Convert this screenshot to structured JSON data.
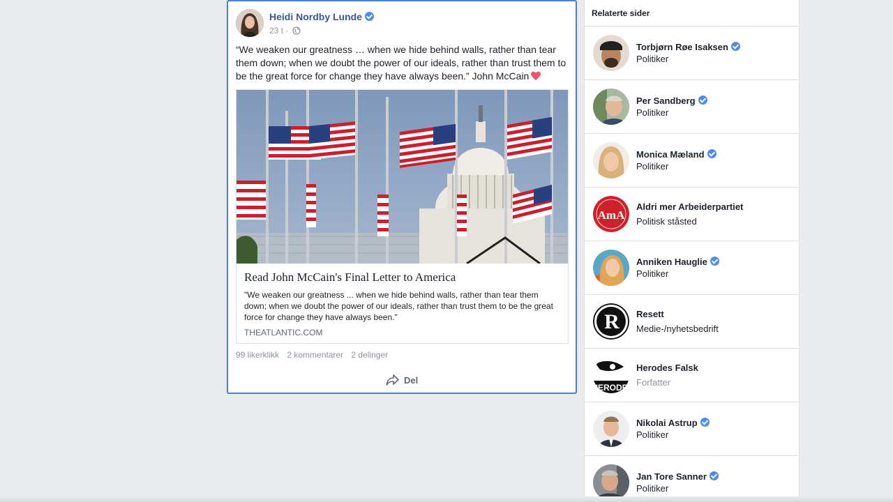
{
  "post": {
    "author": "Heidi Nordby Lunde",
    "time": "23 t ·",
    "text": "“We weaken our greatness … when we hide behind walls, rather than tear them down; when we doubt the power of our ideals, rather than trust them to be the great force for change they have always been.” John McCain",
    "link": {
      "title": "Read John McCain's Final Letter to America",
      "description": "\"We weaken our greatness ... when we hide behind walls, rather than tear them down; when we doubt the power of our ideals, rather than trust them to be the great force for change they have always been.\"",
      "domain": "THEATLANTIC.COM"
    },
    "stats": {
      "likes": "99 likerklikk",
      "comments": "2 kommentarer",
      "shares": "2 delinger"
    },
    "share_label": "Del"
  },
  "related": {
    "header": "Relaterte sider",
    "items": [
      {
        "name": "Torbjørn Røe Isaksen",
        "category": "Politiker",
        "verified": true
      },
      {
        "name": "Per Sandberg",
        "category": "Politiker",
        "verified": true
      },
      {
        "name": "Monica Mæland",
        "category": "Politiker",
        "verified": true
      },
      {
        "name": "Aldri mer Arbeiderpartiet",
        "category": "Politisk ståsted",
        "verified": false
      },
      {
        "name": "Anniken Hauglie",
        "category": "Politiker",
        "verified": true
      },
      {
        "name": "Resett",
        "category": "Medie-/nyhetsbedrift",
        "verified": false
      },
      {
        "name": "Herodes Falsk",
        "category": "Forfatter",
        "verified": false
      },
      {
        "name": "Nikolai Astrup",
        "category": "Politiker",
        "verified": true
      },
      {
        "name": "Jan Tore Sanner",
        "category": "Politiker",
        "verified": true
      }
    ],
    "logo_text": {
      "ama": "AmA",
      "resett": "R",
      "herodes": "HERODE"
    }
  },
  "colors": {
    "link_blue": "#385898",
    "verified_blue": "#4b8bf4",
    "card_border": "#4a7fd4",
    "background": "#e9ebee"
  }
}
